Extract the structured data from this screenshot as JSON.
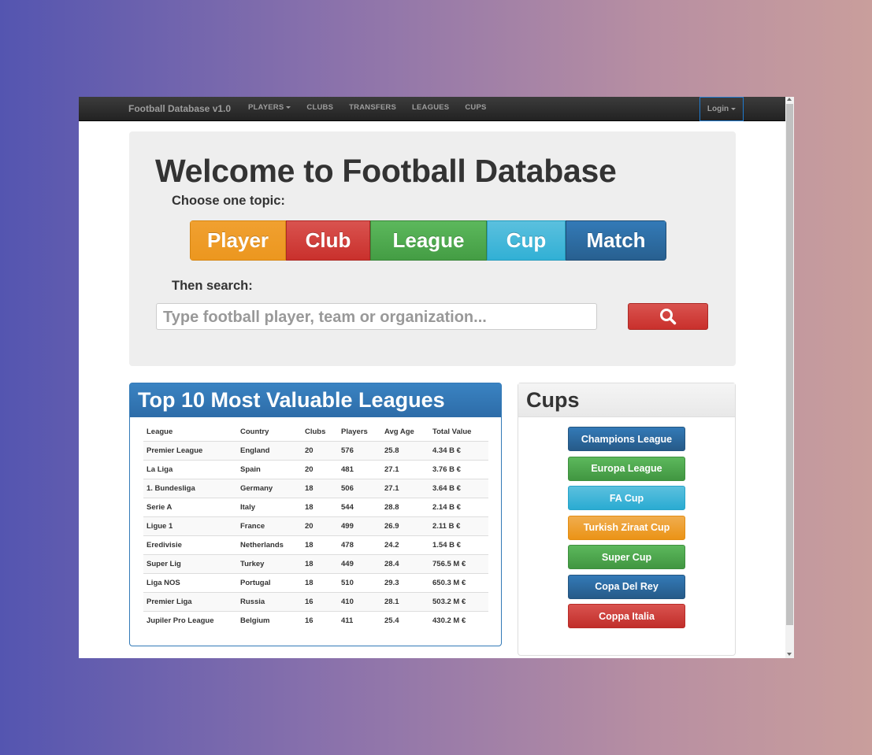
{
  "navbar": {
    "brand": "Football Database v1.0",
    "links": [
      "PLAYERS",
      "CLUBS",
      "TRANSFERS",
      "LEAGUES",
      "CUPS"
    ],
    "login": "Login"
  },
  "jumbotron": {
    "title": "Welcome to Football Database",
    "choose_label": "Choose one topic:",
    "topics": [
      "Player",
      "Club",
      "League",
      "Cup",
      "Match"
    ],
    "then_label": "Then search:",
    "search_placeholder": "Type football player, team or organization...",
    "search_icon": "search-icon"
  },
  "leagues_panel": {
    "title": "Top 10 Most Valuable Leagues",
    "columns": [
      "League",
      "Country",
      "Clubs",
      "Players",
      "Avg Age",
      "Total Value"
    ],
    "rows": [
      [
        "Premier League",
        "England",
        "20",
        "576",
        "25.8",
        "4.34 B €"
      ],
      [
        "La Liga",
        "Spain",
        "20",
        "481",
        "27.1",
        "3.76 B €"
      ],
      [
        "1. Bundesliga",
        "Germany",
        "18",
        "506",
        "27.1",
        "3.64 B €"
      ],
      [
        "Serie A",
        "Italy",
        "18",
        "544",
        "28.8",
        "2.14 B €"
      ],
      [
        "Ligue 1",
        "France",
        "20",
        "499",
        "26.9",
        "2.11 B €"
      ],
      [
        "Eredivisie",
        "Netherlands",
        "18",
        "478",
        "24.2",
        "1.54 B €"
      ],
      [
        "Super Lig",
        "Turkey",
        "18",
        "449",
        "28.4",
        "756.5 M €"
      ],
      [
        "Liga NOS",
        "Portugal",
        "18",
        "510",
        "29.3",
        "650.3 M €"
      ],
      [
        "Premier Liga",
        "Russia",
        "16",
        "410",
        "28.1",
        "503.2 M €"
      ],
      [
        "Jupiler Pro League",
        "Belgium",
        "16",
        "411",
        "25.4",
        "430.2 M €"
      ]
    ]
  },
  "cups_panel": {
    "title": "Cups",
    "buttons": [
      "Champions League",
      "Europa League",
      "FA Cup",
      "Turkish Ziraat Cup",
      "Super Cup",
      "Copa Del Rey",
      "Coppa Italia"
    ]
  },
  "colors": {
    "primary": "#337ab7",
    "success": "#5cb85c",
    "info": "#5bc0de",
    "warning": "#f0ad4e",
    "danger": "#d9534f"
  }
}
